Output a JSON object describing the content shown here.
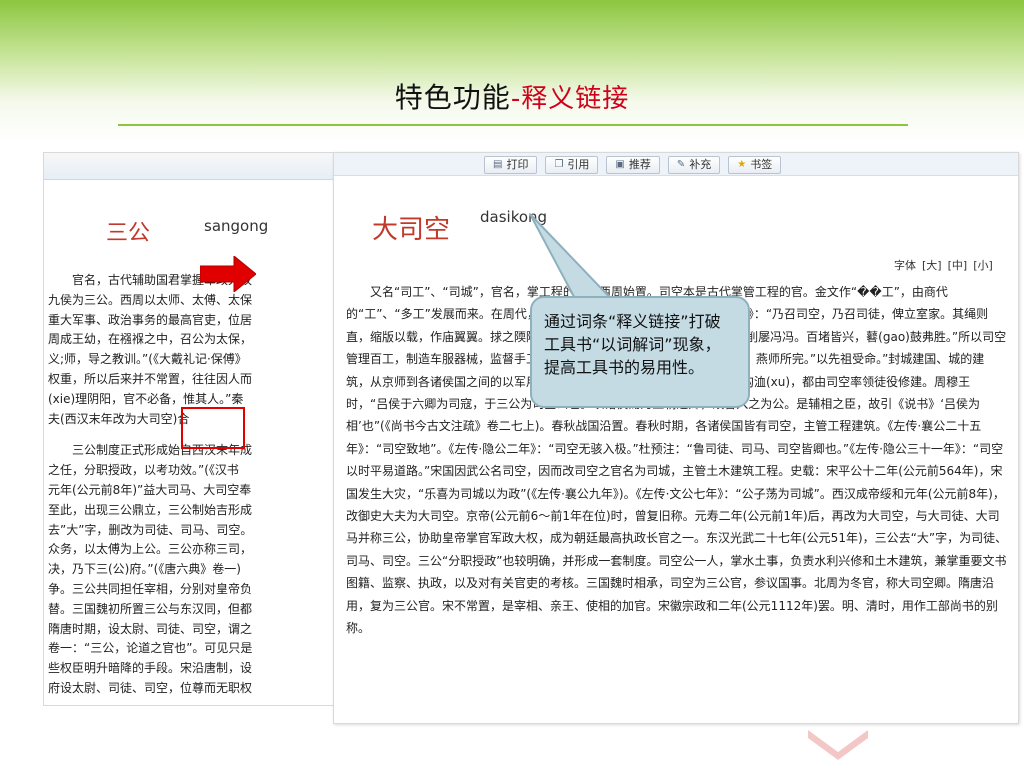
{
  "slide": {
    "title_main": "特色功能",
    "title_sub": "-释义链接"
  },
  "back_page": {
    "headword": "三公",
    "pinyin": "sangong",
    "paragraphs": [
      "官名，古代辅助国君掌握军政大权\n九侯为三公。西周以太师、太傅、太保\n重大军事、政治事务的最高官吏，位居\n周成王幼，在襁褓之中，召公为太保，\n义;师，导之教训。”(《大戴礼记·保傅》\n权重，所以后来并不常置，往往因人而\n(xie)理阴阳，官不必备，惟其人。”秦\n夫(西汉末年改为大司空)合",
      "三公制度正式形成始自西汉末年成\n之任，分职授政，以考功效。”(《汉书\n元年(公元前8年)”益大司马、大司空奉\n至此，出现三公鼎立，三公制始吉形成\n去”大”字，删改为司徒、司马、司空。\n众务，以太傅为上公。三公亦称三司，\n决，乃下三(公)府。”(《唐六典》卷一)\n争。三公共同担任宰相，分别对皇帝负\n替。三国魏初所置三公与东汉同，但都\n隋唐时期，设太尉、司徒、司空，谓之\n卷一：“三公，论道之官也”。可见只是\n些权臣明升暗降的手段。宋沿唐制，设\n府设太尉、司徒、司空，位尊而无职权"
    ]
  },
  "front_page": {
    "toolbar": {
      "print": "打印",
      "cite": "引用",
      "recommend": "推荐",
      "supplement": "补充",
      "bookmark": "书签"
    },
    "headword": "大司空",
    "pinyin": "dasikong",
    "font_size": {
      "label": "字体",
      "large": "[大]",
      "medium": "[中]",
      "small": "[小]"
    },
    "body": "又名“司工”、“司城”，官名，掌工程的官。西周始置。司空本是古代掌管工程的官。金文作“��工”，由商代的“工”、“多工”发展而来。在周代，司空为六卿之一。《诗经·大雅·緜(mian)》：“乃召司空，乃召司徒，俾立室家。其绳则直，缩版以载，作庙翼翼。捄之陾陾(reng)，度之薨薨(hong)，筑之登登，削屡冯冯。百堵皆兴，鼛(gao)鼓弗胜。”所以司空管理百工，制造车服器械，监督手工业奴隶。《诗经·大雅·韩奕》：“溥彼韩城，燕师所完。”以先祖受命。”封城建国、城的建筑，从京师到各诸侯国之间的以军用为主的大道，以及公田灌溉、排水用的沟洫(xu)，都由司空率领徒役修建。周穆王时，“吕侯于六卿为司寇，于三公为司空公也。以诸侯而为王朝之卿，故言入之为公。是辅相之臣，故引《说书》‘吕侯为相’也”(《尚书今古文注疏》卷二七上)。春秋战国沿置。春秋时期，各诸侯国皆有司空，主管工程建筑。《左传·襄公二十五年》：“司空致地”。《左传·隐公二年》：“司空无骇入极。”杜预注：“鲁司徒、司马、司空皆卿也。”《左传·隐公三十一年》：“司空以时平易道路。”宋国因武公名司空，因而改司空之官名为司城，主管土木建筑工程。史载：宋平公十二年(公元前564年)，宋国发生大灾，“乐喜为司城以为政”(《左传·襄公九年》)。《左传·文公七年》：“公子荡为司城”。西汉成帝绥和元年(公元前8年)，改御史大夫为大司空。京帝(公元前6～前1年在位)时，曾复旧称。元寿二年(公元前1年)后，再改为大司空，与大司徒、大司马并称三公，协助皇帝掌官军政大权，成为朝廷最高执政长官之一。东汉光武二十七年(公元51年)，三公去“大”字，为司徒、司马、司空。三公“分职授政”也较明确，并形成一套制度。司空公一人，掌水土事，负责水利兴修和土木建筑，兼掌重要文书图籍、监察、执政，以及对有关官吏的考核。三国魏时相承，司空为三公官，参议国事。北周为冬官，称大司空卿。隋唐沿用，复为三公官。宋不常置，是宰相、亲王、使相的加官。宋徽宗政和二年(公元1112年)罢。明、清时，用作工部尚书的别称。"
  },
  "callout": {
    "text": "通过词条“释义链接”打破工具书“以词解词”现象，提高工具书的易用性。"
  },
  "colors": {
    "title_sub": "#d0021b",
    "headword": "#c0392b",
    "link": "#1a3fd4",
    "callout_fill": "#c4dbe4",
    "highlight": "#e00000",
    "band_green": "#8cc63f"
  }
}
